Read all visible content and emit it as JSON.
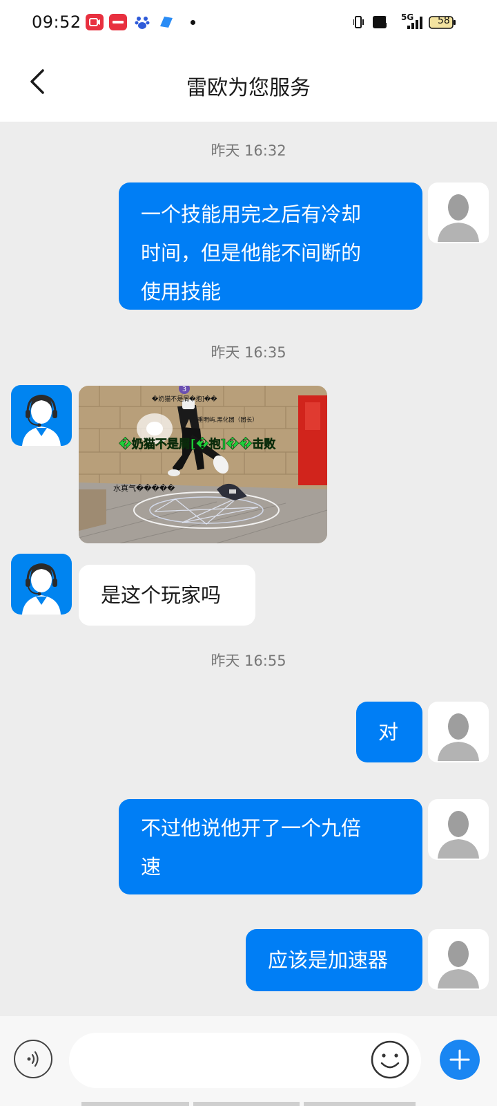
{
  "status_bar": {
    "time": "09:52",
    "battery": "58",
    "network": "5G",
    "hd_label": "HD",
    "app_icons": [
      "screen-recorder-app-icon",
      "xiaohongshu-app-icon",
      "baidu-app-icon",
      "blue-app-icon"
    ]
  },
  "header": {
    "title": "雷欧为您服务"
  },
  "messages": [
    {
      "type": "timestamp",
      "text": "昨天  16:32"
    },
    {
      "type": "text",
      "from": "user",
      "text": "一个技能用完之后有冷却时间，但是他能不间断的使用技能",
      "lines": [
        "一个技能用完之后有冷却",
        "时间，但是他能不间断的",
        "使用技能"
      ]
    },
    {
      "type": "timestamp",
      "text": "昨天  16:35"
    },
    {
      "type": "image",
      "from": "agent",
      "overlay": {
        "player_name": "�奶猫不是屑[�抱]��击败",
        "top_name": "�奶猫不是屑�抱]��",
        "guild": "重明屿.黑化团（团长）",
        "level": "3",
        "skill": "水真气�����"
      }
    },
    {
      "type": "text",
      "from": "agent",
      "text": "是这个玩家吗"
    },
    {
      "type": "timestamp",
      "text": "昨天  16:55"
    },
    {
      "type": "text",
      "from": "user",
      "text": "对"
    },
    {
      "type": "text",
      "from": "user",
      "text": "不过他说他开了一个九倍速",
      "lines": [
        "不过他说他开了一个九倍",
        "速"
      ]
    },
    {
      "type": "text",
      "from": "user",
      "text": "应该是加速器"
    }
  ],
  "input_bar": {
    "placeholder": ""
  }
}
